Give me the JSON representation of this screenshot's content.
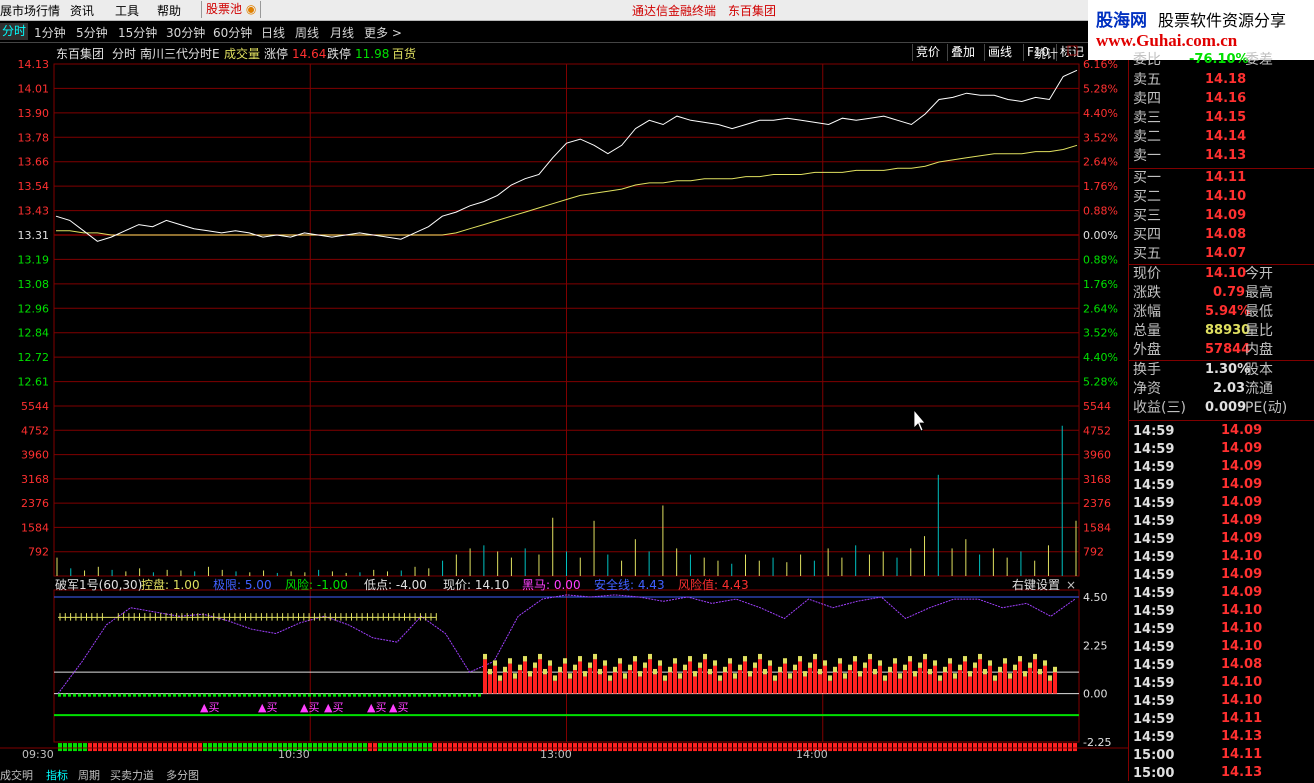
{
  "menubar": {
    "items": [
      "展市场行情",
      "资讯",
      "工具",
      "帮助"
    ],
    "stock_pool": "股票池",
    "center_links": [
      "通达信金融终端",
      "东百集团"
    ]
  },
  "periods": [
    "分时",
    "1分钟",
    "5分钟",
    "15分钟",
    "30分钟",
    "60分钟",
    "日线",
    "周线",
    "月线",
    "更多 >"
  ],
  "tool_buttons": [
    "竞价",
    "叠加",
    "画线",
    "F10",
    "标记"
  ],
  "logo": {
    "line1_blue": "股海网",
    "line1_black": "股票软件资源分享",
    "line2": "www.Guhai.com.cn"
  },
  "chart_header": {
    "stock_name": "东百集团",
    "mode": "分时",
    "indicator": "南川三代分时E",
    "volume_label": "成交量",
    "limit_up_label": "涨停",
    "limit_up": "14.64",
    "limit_down_label": "跌停",
    "limit_down": "11.98",
    "sector": "百货",
    "stats": "统计"
  },
  "price_axis_left": [
    "14.13",
    "14.01",
    "13.90",
    "13.78",
    "13.66",
    "13.54",
    "13.43",
    "13.31",
    "13.19",
    "13.08",
    "12.96",
    "12.84",
    "12.72",
    "12.61"
  ],
  "price_axis_right": [
    "6.16%",
    "5.28%",
    "4.40%",
    "3.52%",
    "2.64%",
    "1.76%",
    "0.88%",
    "0.00%",
    "0.88%",
    "1.76%",
    "2.64%",
    "3.52%",
    "4.40%",
    "5.28%"
  ],
  "volume_axis": [
    "5544",
    "4752",
    "3960",
    "3168",
    "2376",
    "1584",
    "792"
  ],
  "indicator_header": {
    "name": "破军1号(60,30)",
    "items": [
      {
        "label": "控盘:",
        "value": "1.00",
        "color": "#e0e060"
      },
      {
        "label": "极限:",
        "value": "5.00",
        "color": "#4060ff"
      },
      {
        "label": "风险:",
        "value": "-1.00",
        "color": "#00e000"
      },
      {
        "label": "低点:",
        "value": "-4.00",
        "color": "#e0e0e0"
      },
      {
        "label": "现价:",
        "value": "14.10",
        "color": "#e0e0e0"
      },
      {
        "label": "黑马:",
        "value": "0.00",
        "color": "#ff40ff"
      },
      {
        "label": "安全线:",
        "value": "4.43",
        "color": "#4060ff"
      },
      {
        "label": "风险值:",
        "value": "4.43",
        "color": "#ff3030"
      }
    ],
    "settings": "右键设置",
    "close": "×"
  },
  "indicator_axis": [
    "4.50",
    "2.25",
    "0.00",
    "-2.25"
  ],
  "buy_marker": "▲买",
  "time_axis": [
    "09:30",
    "10:30",
    "13:00",
    "14:00"
  ],
  "bottom_tabs": [
    "成交明",
    "指标",
    "周期",
    "买卖力道",
    "多分图"
  ],
  "series_colors": {
    "price": "#ffffff",
    "avg": "#e0e060",
    "grid": "#800000",
    "up": "#ff3030",
    "down": "#00e000"
  },
  "chart_data": {
    "type": "line",
    "title": "东百集团 分时",
    "prev_close": 13.31,
    "ylim": [
      12.49,
      14.13
    ],
    "price_series": [
      13.4,
      13.38,
      13.33,
      13.28,
      13.3,
      13.33,
      13.36,
      13.35,
      13.38,
      13.36,
      13.34,
      13.33,
      13.32,
      13.33,
      13.32,
      13.3,
      13.31,
      13.3,
      13.32,
      13.31,
      13.3,
      13.31,
      13.32,
      13.31,
      13.3,
      13.29,
      13.32,
      13.35,
      13.4,
      13.42,
      13.45,
      13.47,
      13.5,
      13.55,
      13.58,
      13.6,
      13.68,
      13.75,
      13.77,
      13.74,
      13.7,
      13.74,
      13.82,
      13.86,
      13.84,
      13.88,
      13.86,
      13.85,
      13.84,
      13.82,
      13.84,
      13.86,
      13.86,
      13.87,
      13.86,
      13.85,
      13.84,
      13.87,
      13.86,
      13.87,
      13.88,
      13.86,
      13.84,
      13.89,
      13.96,
      13.97,
      13.99,
      13.98,
      13.98,
      13.96,
      13.95,
      13.97,
      13.96,
      14.07,
      14.1
    ],
    "avg_series": [
      13.33,
      13.33,
      13.32,
      13.32,
      13.31,
      13.31,
      13.31,
      13.31,
      13.31,
      13.31,
      13.31,
      13.31,
      13.31,
      13.31,
      13.31,
      13.31,
      13.31,
      13.31,
      13.31,
      13.31,
      13.31,
      13.31,
      13.31,
      13.31,
      13.31,
      13.31,
      13.31,
      13.31,
      13.31,
      13.32,
      13.34,
      13.36,
      13.38,
      13.4,
      13.42,
      13.44,
      13.46,
      13.48,
      13.5,
      13.51,
      13.52,
      13.53,
      13.55,
      13.56,
      13.56,
      13.57,
      13.57,
      13.58,
      13.58,
      13.58,
      13.59,
      13.59,
      13.6,
      13.6,
      13.6,
      13.61,
      13.61,
      13.61,
      13.62,
      13.62,
      13.62,
      13.63,
      13.63,
      13.64,
      13.66,
      13.67,
      13.68,
      13.69,
      13.7,
      13.7,
      13.7,
      13.71,
      13.71,
      13.72,
      13.74
    ],
    "volume_ylim": [
      0,
      5544
    ],
    "volume_series": [
      600,
      250,
      180,
      300,
      200,
      150,
      250,
      120,
      200,
      180,
      150,
      300,
      200,
      150,
      120,
      180,
      100,
      150,
      120,
      200,
      150,
      100,
      120,
      200,
      150,
      180,
      300,
      250,
      500,
      700,
      900,
      1000,
      800,
      600,
      900,
      700,
      1900,
      800,
      600,
      1800,
      700,
      500,
      1200,
      800,
      2300,
      900,
      700,
      600,
      500,
      400,
      700,
      500,
      600,
      450,
      700,
      500,
      900,
      600,
      1000,
      700,
      800,
      600,
      900,
      1300,
      3300,
      900,
      1200,
      700,
      900,
      600,
      800,
      500,
      1000,
      4900,
      1800
    ]
  }
}
